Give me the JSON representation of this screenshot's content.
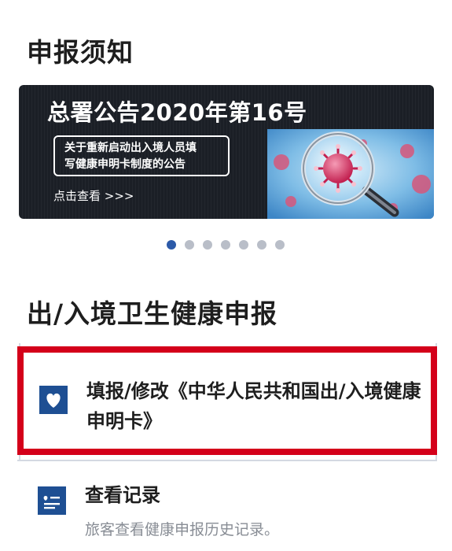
{
  "notice_section": {
    "title": "申报须知"
  },
  "banner": {
    "headline": "总署公告2020年第16号",
    "box_lines": [
      "关于重新启动出入境人员填",
      "写健康申明卡制度的公告"
    ],
    "link_text": "点击查看 >>>",
    "image_subject": "virus-under-magnifier"
  },
  "carousel": {
    "total": 7,
    "active_index": 0
  },
  "health_section": {
    "title": "出/入境卫生健康申报"
  },
  "cards": {
    "declare": {
      "icon": "heart-icon",
      "label": "填报/修改《中华人民共和国出/入境健康申明卡》"
    },
    "records": {
      "icon": "record-icon",
      "label": "查看记录",
      "subtitle": "旅客查看健康申报历史记录。"
    }
  },
  "colors": {
    "accent": "#1e4f93",
    "highlight_border": "#d4001a",
    "dot_active": "#2c5aa8",
    "dot_inactive": "#b9bec8",
    "banner_bg": "#1b1f26"
  }
}
